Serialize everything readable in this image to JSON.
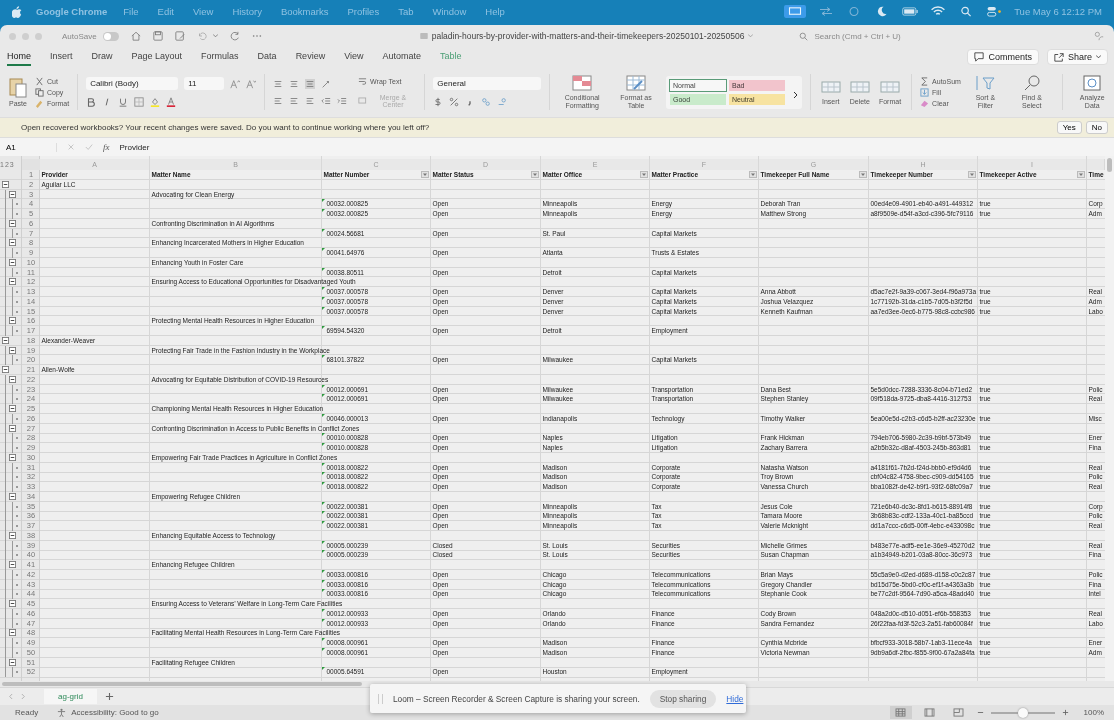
{
  "menubar": {
    "app": "Google Chrome",
    "menus": [
      "File",
      "Edit",
      "View",
      "History",
      "Bookmarks",
      "Profiles",
      "Tab",
      "Window",
      "Help"
    ],
    "clock": "Tue May 6  12:12 PM"
  },
  "titlebar": {
    "autosave_label": "AutoSave",
    "autosave_on": false,
    "title": "paladin-hours-by-provider-with-matters-and-their-timekeepers-20250101-20250506",
    "search_placeholder": "Search (Cmd + Ctrl + U)"
  },
  "ribbon_tabs": [
    {
      "label": "Home",
      "selected": true,
      "contextual": false
    },
    {
      "label": "Insert",
      "selected": false,
      "contextual": false
    },
    {
      "label": "Draw",
      "selected": false,
      "contextual": false
    },
    {
      "label": "Page Layout",
      "selected": false,
      "contextual": false
    },
    {
      "label": "Formulas",
      "selected": false,
      "contextual": false
    },
    {
      "label": "Data",
      "selected": false,
      "contextual": false
    },
    {
      "label": "Review",
      "selected": false,
      "contextual": false
    },
    {
      "label": "View",
      "selected": false,
      "contextual": false
    },
    {
      "label": "Automate",
      "selected": false,
      "contextual": false
    },
    {
      "label": "Table",
      "selected": false,
      "contextual": true
    }
  ],
  "ribbon_actions": {
    "comments": "Comments",
    "share": "Share"
  },
  "ribbon": {
    "paste": "Paste",
    "cut": "Cut",
    "copy": "Copy",
    "format_painter": "Format",
    "font_family": "Calibri (Body)",
    "font_size": "11",
    "wrap_text": "Wrap Text",
    "merge": "Merge & Center",
    "number_format": "General",
    "conditional": "Conditional Formatting",
    "format_table": "Format as Table",
    "styles": [
      {
        "label": "Normal",
        "color": "#f7f7f7",
        "selected": true
      },
      {
        "label": "Bad",
        "color": "#f2c4cc",
        "selected": false
      },
      {
        "label": "Good",
        "color": "#c9ebcb",
        "selected": false
      },
      {
        "label": "Neutral",
        "color": "#f7e3a1",
        "selected": false
      }
    ],
    "cells": [
      "Insert",
      "Delete",
      "Format"
    ],
    "autosum": "AutoSum",
    "fill": "Fill",
    "clear": "Clear",
    "sort": "Sort & Filter",
    "find": "Find & Select",
    "analyze": "Analyze Data"
  },
  "notification": {
    "message": "Open recovered workbooks?  Your recent changes were saved. Do you want to continue working where you left off?",
    "buttons": [
      "Yes",
      "No"
    ]
  },
  "formula_bar": {
    "cell_ref": "A1",
    "fx": "fx",
    "value": "Provider"
  },
  "sheet": {
    "outline_levels": [
      "1",
      "2",
      "3"
    ],
    "header_row": "1",
    "columns": [
      {
        "letter": "A",
        "header": "Provider",
        "filter": false
      },
      {
        "letter": "B",
        "header": "Matter Name",
        "filter": false
      },
      {
        "letter": "C",
        "header": "Matter Number",
        "filter": true
      },
      {
        "letter": "D",
        "header": "Matter Status",
        "filter": true
      },
      {
        "letter": "E",
        "header": "Matter Office",
        "filter": true
      },
      {
        "letter": "F",
        "header": "Matter Practice",
        "filter": true
      },
      {
        "letter": "G",
        "header": "Timekeeper Full Name",
        "filter": true
      },
      {
        "letter": "H",
        "header": "Timekeeper Number",
        "filter": true
      },
      {
        "letter": "I",
        "header": "Timekeeper Active",
        "filter": true
      },
      {
        "header": "Time",
        "filter": false
      }
    ],
    "providers": [
      {
        "row": "2",
        "name": "Aguilar LLC",
        "expanded": true,
        "matters": [
          {
            "row": "3",
            "name": "Advocating for Clean Energy",
            "expanded": true,
            "entries": [
              {
                "row": "4",
                "number": "00032.000825",
                "status": "Open",
                "office": "Minneapolis",
                "practice": "Energy",
                "timekeeper": "Deborah Tran",
                "timekeeper_number": "00ed4e09-4901-eb40-a491-449312",
                "active": "true",
                "column_10": "Corp"
              },
              {
                "row": "5",
                "number": "00032.000825",
                "status": "Open",
                "office": "Minneapolis",
                "practice": "Energy",
                "timekeeper": "Matthew Strong",
                "timekeeper_number": "a8f9509e-d54f-a3cd-c396-5fc79116",
                "active": "true",
                "column_10": "Adm"
              }
            ]
          },
          {
            "row": "6",
            "name": "Confronting Discrimination in AI Algorithms",
            "expanded": true,
            "entries": [
              {
                "row": "7",
                "number": "00024.56681",
                "status": "Open",
                "office": "St. Paul",
                "practice": "Capital Markets"
              }
            ]
          },
          {
            "row": "8",
            "name": "Enhancing Incarcerated Mothers in Higher Education",
            "expanded": true,
            "entries": [
              {
                "row": "9",
                "number": "00041.64976",
                "status": "Open",
                "office": "Atlanta",
                "practice": "Trusts & Estates"
              }
            ]
          },
          {
            "row": "10",
            "name": "Enhancing Youth in Foster Care",
            "expanded": true,
            "entries": [
              {
                "row": "11",
                "number": "00038.80511",
                "status": "Open",
                "office": "Detroit",
                "practice": "Capital Markets"
              }
            ]
          },
          {
            "row": "12",
            "name": "Ensuring Access to Educational Opportunities for Disadvantaged Youth",
            "expanded": true,
            "entries": [
              {
                "row": "13",
                "number": "00037.000578",
                "status": "Open",
                "office": "Denver",
                "practice": "Capital Markets",
                "timekeeper": "Anna Abbott",
                "timekeeper_number": "d5ac7e2f-9a39-c067-3ed4-f96a973a",
                "active": "true",
                "column_10": "Real"
              },
              {
                "row": "14",
                "number": "00037.000578",
                "status": "Open",
                "office": "Denver",
                "practice": "Capital Markets",
                "timekeeper": "Joshua Velazquez",
                "timekeeper_number": "1c77192b-31da-c1b5-7d05-b3f2f5d",
                "active": "true",
                "column_10": "Adm"
              },
              {
                "row": "15",
                "number": "00037.000578",
                "status": "Open",
                "office": "Denver",
                "practice": "Capital Markets",
                "timekeeper": "Kenneth Kaufman",
                "timekeeper_number": "aa7ed3ee-0ec6-b775-98c8-ccbc986",
                "active": "true",
                "column_10": "Labo"
              }
            ]
          },
          {
            "row": "16",
            "name": "Protecting Mental Health Resources in Higher Education",
            "expanded": true,
            "entries": [
              {
                "row": "17",
                "number": "69594.54320",
                "status": "Open",
                "office": "Detroit",
                "practice": "Employment"
              }
            ]
          }
        ]
      },
      {
        "row": "18",
        "name": "Alexander-Weaver",
        "expanded": true,
        "matters": [
          {
            "row": "19",
            "name": "Protecting Fair Trade in the Fashion Industry in the Workplace",
            "expanded": true,
            "entries": [
              {
                "row": "20",
                "number": "68101.37822",
                "status": "Open",
                "office": "Milwaukee",
                "practice": "Capital Markets"
              }
            ]
          }
        ]
      },
      {
        "row": "21",
        "name": "Allen-Wolfe",
        "expanded": true,
        "matters": [
          {
            "row": "22",
            "name": "Advocating for Equitable Distribution of COVID-19 Resources",
            "expanded": true,
            "entries": [
              {
                "row": "23",
                "number": "00012.000691",
                "status": "Open",
                "office": "Milwaukee",
                "practice": "Transportation",
                "timekeeper": "Dana Best",
                "timekeeper_number": "5e5d0dcc-7288-3336-8c04-b71ed2",
                "active": "true",
                "column_10": "Polic"
              },
              {
                "row": "24",
                "number": "00012.000691",
                "status": "Open",
                "office": "Milwaukee",
                "practice": "Transportation",
                "timekeeper": "Stephen Stanley",
                "timekeeper_number": "09f518da-9725-dba8-4416-312753",
                "active": "true",
                "column_10": "Real"
              }
            ]
          },
          {
            "row": "25",
            "name": "Championing Mental Health Resources in Higher Education",
            "expanded": true,
            "entries": [
              {
                "row": "26",
                "number": "00046.000013",
                "status": "Open",
                "office": "Indianapolis",
                "practice": "Technology",
                "timekeeper": "Timothy Walker",
                "timekeeper_number": "5ea00e5d-c2b3-c6d5-b2ff-ac23230e",
                "active": "true",
                "column_10": "Misc"
              }
            ]
          },
          {
            "row": "27",
            "name": "Confronting Discrimination in Access to Public Benefits in Conflict Zones",
            "expanded": true,
            "entries": [
              {
                "row": "28",
                "number": "00010.000828",
                "status": "Open",
                "office": "Naples",
                "practice": "Litigation",
                "timekeeper": "Frank Hickman",
                "timekeeper_number": "794eb706-5980-2c39-b9bf-573b49",
                "active": "true",
                "column_10": "Ener"
              },
              {
                "row": "29",
                "number": "00010.000828",
                "status": "Open",
                "office": "Naples",
                "practice": "Litigation",
                "timekeeper": "Zachary Barrera",
                "timekeeper_number": "a2b5b32c-d8af-4503-245b-863d81",
                "active": "true",
                "column_10": "Fina"
              }
            ]
          },
          {
            "row": "30",
            "name": "Empowering Fair Trade Practices in Agriculture in Conflict Zones",
            "expanded": true,
            "entries": [
              {
                "row": "31",
                "number": "00018.000822",
                "status": "Open",
                "office": "Madison",
                "practice": "Corporate",
                "timekeeper": "Natasha Watson",
                "timekeeper_number": "a4181f61-7b2d-f24d-bbb0-ef9d4d6",
                "active": "true",
                "column_10": "Real"
              },
              {
                "row": "32",
                "number": "00018.000822",
                "status": "Open",
                "office": "Madison",
                "practice": "Corporate",
                "timekeeper": "Troy Brown",
                "timekeeper_number": "cbf04c82-4758-9bec-c909-dd54165",
                "active": "true",
                "column_10": "Polic"
              },
              {
                "row": "33",
                "number": "00018.000822",
                "status": "Open",
                "office": "Madison",
                "practice": "Corporate",
                "timekeeper": "Vanessa Church",
                "timekeeper_number": "bba1082f-de42-b9f1-93f2-68fc09a7",
                "active": "true",
                "column_10": "Real"
              }
            ]
          },
          {
            "row": "34",
            "name": "Empowering Refugee Children",
            "expanded": true,
            "entries": [
              {
                "row": "35",
                "number": "00022.000381",
                "status": "Open",
                "office": "Minneapolis",
                "practice": "Tax",
                "timekeeper": "Jesus Cole",
                "timekeeper_number": "721e6b40-dc3c-8fd1-b615-88914f8",
                "active": "true",
                "column_10": "Corp"
              },
              {
                "row": "36",
                "number": "00022.000381",
                "status": "Open",
                "office": "Minneapolis",
                "practice": "Tax",
                "timekeeper": "Tamara Moore",
                "timekeeper_number": "3b68b83c-cdf2-133a-40c1-ba85ccd",
                "active": "true",
                "column_10": "Polic"
              },
              {
                "row": "37",
                "number": "00022.000381",
                "status": "Open",
                "office": "Minneapolis",
                "practice": "Tax",
                "timekeeper": "Valerie Mcknight",
                "timekeeper_number": "dd1a7ccc-c6d5-00ff-4ebc-e433098c",
                "active": "true",
                "column_10": "Real"
              }
            ]
          },
          {
            "row": "38",
            "name": "Enhancing Equitable Access to Technology",
            "expanded": true,
            "entries": [
              {
                "row": "39",
                "number": "00005.000239",
                "status": "Closed",
                "office": "St. Louis",
                "practice": "Securities",
                "timekeeper": "Michelle Grimes",
                "timekeeper_number": "b483e77e-adf5-ee1e-36e9-45270d2",
                "active": "true",
                "column_10": "Real"
              },
              {
                "row": "40",
                "number": "00005.000239",
                "status": "Closed",
                "office": "St. Louis",
                "practice": "Securities",
                "timekeeper": "Susan Chapman",
                "timekeeper_number": "a1b34949-b201-03a8-80cc-36c973",
                "active": "true",
                "column_10": "Fina"
              }
            ]
          },
          {
            "row": "41",
            "name": "Enhancing Refugee Children",
            "expanded": true,
            "entries": [
              {
                "row": "42",
                "number": "00033.000816",
                "status": "Open",
                "office": "Chicago",
                "practice": "Telecommunications",
                "timekeeper": "Brian Mays",
                "timekeeper_number": "55c5a9e0-d2ed-d689-d158-c0c2c87",
                "active": "true",
                "column_10": "Polic"
              },
              {
                "row": "43",
                "number": "00033.000816",
                "status": "Open",
                "office": "Chicago",
                "practice": "Telecommunications",
                "timekeeper": "Gregory Chandler",
                "timekeeper_number": "bd15d75e-5bd0-cf0c-ef1f-a4363a3b",
                "active": "true",
                "column_10": "Fina"
              },
              {
                "row": "44",
                "number": "00033.000816",
                "status": "Open",
                "office": "Chicago",
                "practice": "Telecommunications",
                "timekeeper": "Stephanie Cook",
                "timekeeper_number": "be77c2df-9564-7d90-a5ca-48add40",
                "active": "true",
                "column_10": "Intel"
              }
            ]
          },
          {
            "row": "45",
            "name": "Ensuring Access to Veterans’ Welfare in Long-Term Care Facilities",
            "expanded": true,
            "entries": [
              {
                "row": "46",
                "number": "00012.000933",
                "status": "Open",
                "office": "Orlando",
                "practice": "Finance",
                "timekeeper": "Cody Brown",
                "timekeeper_number": "048a2d0c-d510-d051-ef6b-558353",
                "active": "true",
                "column_10": "Real"
              },
              {
                "row": "47",
                "number": "00012.000933",
                "status": "Open",
                "office": "Orlando",
                "practice": "Finance",
                "timekeeper": "Sandra Fernandez",
                "timekeeper_number": "26f22faa-fd3f-52c3-2a51-fab60084f",
                "active": "true",
                "column_10": "Labo"
              }
            ]
          },
          {
            "row": "48",
            "name": "Facilitating Mental Health Resources in Long-Term Care Facilities",
            "expanded": true,
            "entries": [
              {
                "row": "49",
                "number": "00008.000961",
                "status": "Open",
                "office": "Madison",
                "practice": "Finance",
                "timekeeper": "Cynthia Mcbride",
                "timekeeper_number": "bfbcf933-3018-58b7-1ab3-11ece4a",
                "active": "true",
                "column_10": "Ener"
              },
              {
                "row": "50",
                "number": "00008.000961",
                "status": "Open",
                "office": "Madison",
                "practice": "Finance",
                "timekeeper": "Victoria Newman",
                "timekeeper_number": "9db9a6df-2fbc-f855-9f00-67a2a84fa",
                "active": "true",
                "column_10": "Adm"
              }
            ]
          },
          {
            "row": "51",
            "name": "Facilitating Refugee Children",
            "expanded": true,
            "entries": [
              {
                "row": "52",
                "number": "00005.64591",
                "status": "Open",
                "office": "Houston",
                "practice": "Employment"
              }
            ]
          }
        ]
      }
    ]
  },
  "sheet_tabs": [
    {
      "label": "ag-grid",
      "selected": true
    }
  ],
  "loom": {
    "message": "Loom – Screen Recorder & Screen Capture is sharing your screen.",
    "stop": "Stop sharing",
    "hide": "Hide"
  },
  "status_bar": {
    "ready": "Ready",
    "accessibility": "Accessibility: Good to go",
    "views": [
      {
        "selected": true
      },
      {
        "selected": false
      },
      {
        "selected": false
      }
    ],
    "zoom_slider": {
      "level": 0.5
    },
    "zoom": "100%"
  }
}
